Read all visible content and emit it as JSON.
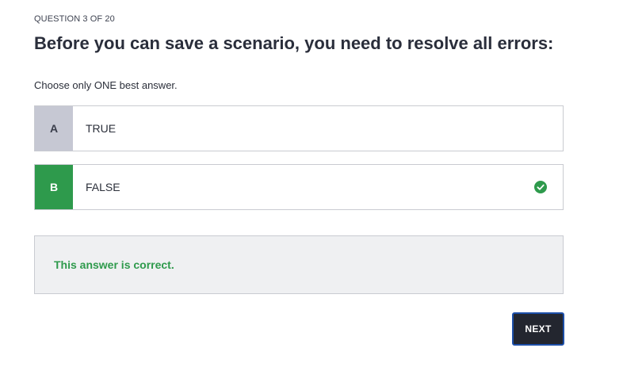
{
  "quiz": {
    "counter": "QUESTION 3 OF 20",
    "question": "Before you can save a scenario, you need to resolve all errors:",
    "instruction": "Choose only ONE best answer."
  },
  "options": [
    {
      "letter": "A",
      "text": "TRUE",
      "selected": false
    },
    {
      "letter": "B",
      "text": "FALSE",
      "selected": true,
      "status_icon": "check-circle-icon"
    }
  ],
  "feedback": {
    "message": "This answer is correct."
  },
  "actions": {
    "next_label": "NEXT"
  },
  "colors": {
    "correct": "#2e9a4c",
    "neutral_letter_bg": "#c6c8d3",
    "button_bg": "#23262f",
    "button_border": "#1d4fa8"
  }
}
